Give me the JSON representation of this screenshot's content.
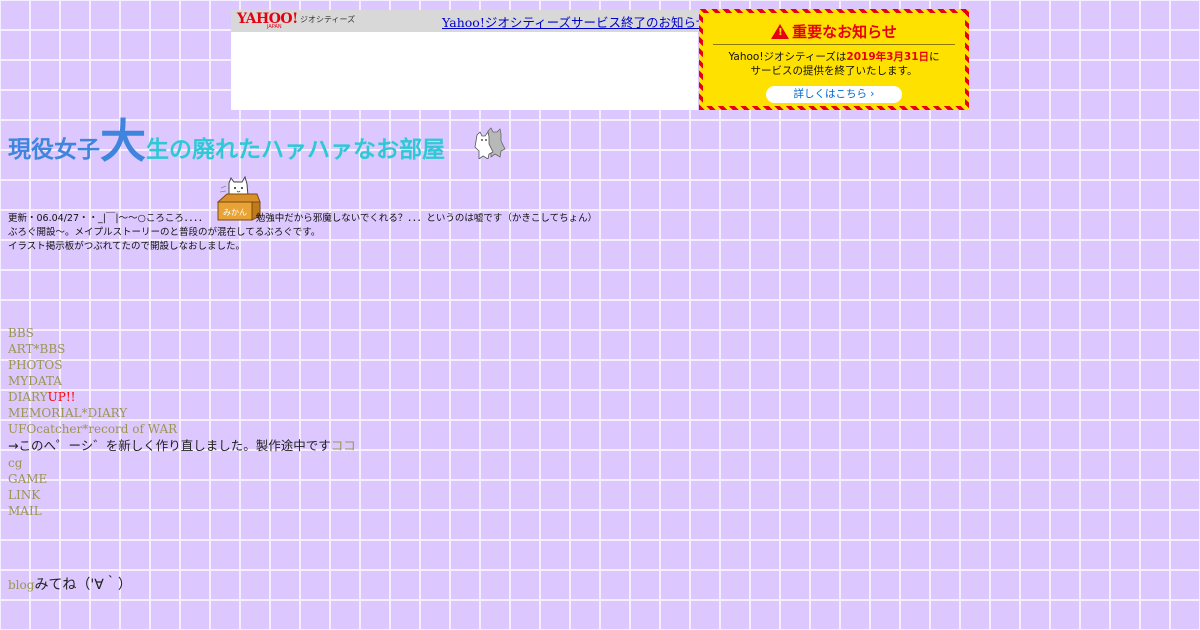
{
  "yahoo_banner": {
    "logo_text": "YAHOO!",
    "logo_sub": "JAPAN",
    "service_name": "ジオシティーズ",
    "notice_link": "Yahoo!ジオシティーズサービス終了のお知らせ"
  },
  "important_notice": {
    "title": "重要なお知らせ",
    "body_prefix": "Yahoo!ジオシティーズは",
    "body_date": "2019年3月31日",
    "body_suffix": "に",
    "body_line2": "サービスの提供を終了いたします。",
    "details_button": "詳しくはこちら ›",
    "accent_color": "#e60012",
    "background_color": "#ffe100"
  },
  "site": {
    "title_part1": "現役女子",
    "title_big": "大",
    "title_part2": "生の廃れたハァハァなお部屋",
    "mikan_label": "みかん"
  },
  "updates": {
    "line1_before": "更新・06.04/27・・_|￣|～～○ころころ．．．．",
    "line1_after": "勉強中だから邪魔しないでくれる？．．．というのは嘘です（かきこしてちょん）",
    "line2": "ぶろぐ開設～。メイプルストーリーのと普段のが混在してるぶろぐです。",
    "line3": "イラスト掲示板がつぶれてたので開設しなおしました。"
  },
  "nav": {
    "bbs": "BBS",
    "art_bbs": "ART*BBS",
    "photos": "PHOTOS",
    "mydata": "MYDATA",
    "diary": "DIARY",
    "diary_badge": "UP!!",
    "memorial_diary": "MEMORIAL*DIARY",
    "ufocatcher": "UFOcatcher*record of WAR",
    "rebuild_text": "→このへ゜ーシ゛を新しく作り直しました。製作途中です",
    "rebuild_link": "ココ",
    "cg": "cg",
    "game": "GAME",
    "link": "LINK",
    "mail": "MAIL"
  },
  "blog": {
    "link": "blog",
    "text": "みてね（'∀｀）"
  },
  "colors": {
    "link": "#9c9550",
    "background": "#dcc8ff",
    "title_blue": "#3f85dd",
    "title_cyan": "#2ec9d6"
  }
}
